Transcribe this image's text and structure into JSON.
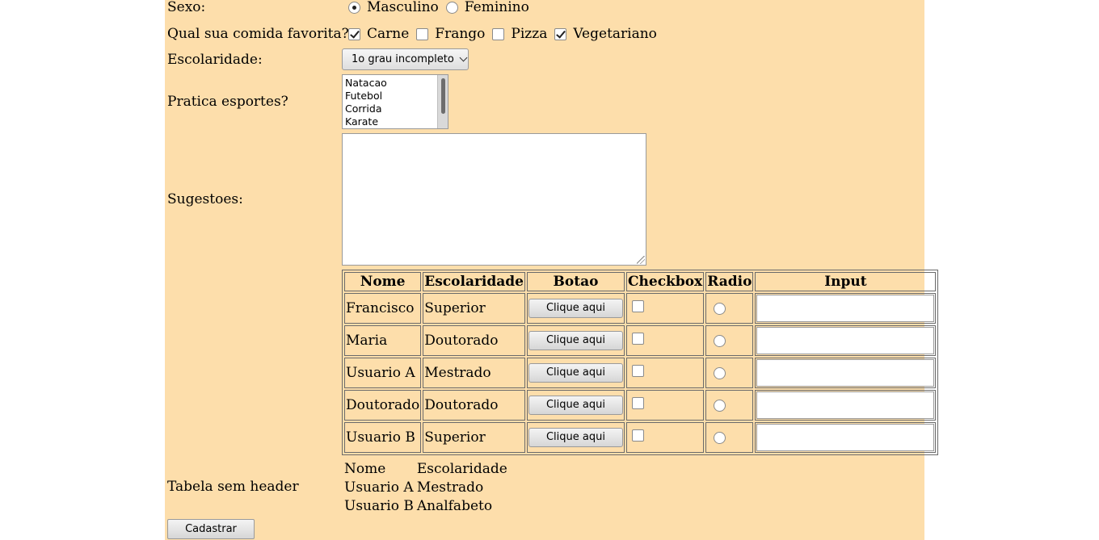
{
  "sexo": {
    "label": "Sexo:",
    "options": [
      {
        "label": "Masculino",
        "selected": true
      },
      {
        "label": "Feminino",
        "selected": false
      }
    ]
  },
  "comida": {
    "label": "Qual sua comida favorita?",
    "options": [
      {
        "label": "Carne",
        "checked": true
      },
      {
        "label": "Frango",
        "checked": false
      },
      {
        "label": "Pizza",
        "checked": false
      },
      {
        "label": "Vegetariano",
        "checked": true
      }
    ]
  },
  "escolaridade": {
    "label": "Escolaridade:",
    "selected": "1o grau incompleto"
  },
  "esportes": {
    "label": "Pratica esportes?",
    "options": [
      "Natacao",
      "Futebol",
      "Corrida",
      "Karate"
    ]
  },
  "sugestoes": {
    "label": "Sugestoes:",
    "value": ""
  },
  "tabela": {
    "headers": [
      "Nome",
      "Escolaridade",
      "Botao",
      "Checkbox",
      "Radio",
      "Input"
    ],
    "button_label": "Clique aqui",
    "rows": [
      {
        "nome": "Francisco",
        "escolaridade": "Superior"
      },
      {
        "nome": "Maria",
        "escolaridade": "Doutorado"
      },
      {
        "nome": "Usuario A",
        "escolaridade": "Mestrado"
      },
      {
        "nome": "Doutorado",
        "escolaridade": "Doutorado"
      },
      {
        "nome": "Usuario B",
        "escolaridade": "Superior"
      }
    ]
  },
  "tabela_sem_header": {
    "label": "Tabela sem header",
    "rows": [
      [
        "Nome",
        "Escolaridade"
      ],
      [
        "Usuario A",
        "Mestrado"
      ],
      [
        "Usuario B",
        "Analfabeto"
      ]
    ]
  },
  "submit_label": "Cadastrar"
}
